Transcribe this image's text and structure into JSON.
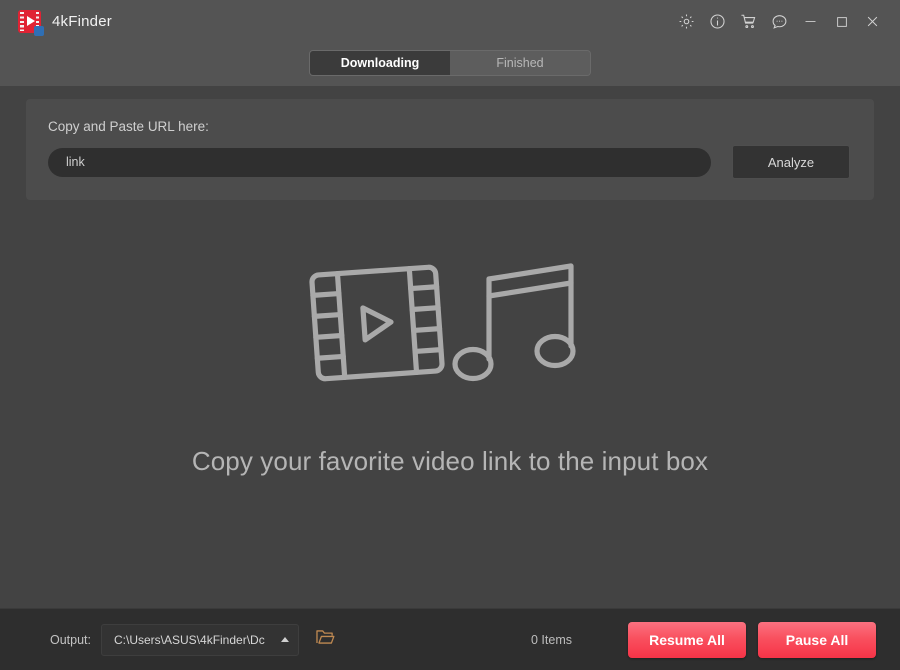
{
  "window": {
    "app_title": "4kFinder",
    "logo_icon": "film-play-icon",
    "controls": [
      {
        "name": "settings-icon",
        "label": "Settings"
      },
      {
        "name": "info-icon",
        "label": "Info"
      },
      {
        "name": "cart-icon",
        "label": "Store"
      },
      {
        "name": "chat-icon",
        "label": "Feedback"
      },
      {
        "name": "minimize-icon",
        "label": "Minimize"
      },
      {
        "name": "maximize-icon",
        "label": "Maximize"
      },
      {
        "name": "close-icon",
        "label": "Close"
      }
    ]
  },
  "tabs": [
    {
      "label": "Downloading",
      "active": true
    },
    {
      "label": "Finished",
      "active": false
    }
  ],
  "url_panel": {
    "label": "Copy and Paste URL here:",
    "input_value": "link",
    "input_placeholder": "link",
    "analyze_label": "Analyze"
  },
  "empty_state": {
    "message": "Copy your favorite video link to the input box",
    "icons": [
      "film-strip-icon",
      "music-note-icon"
    ]
  },
  "footer": {
    "output_label": "Output:",
    "output_path": "C:\\Users\\ASUS\\4kFinder\\Dc",
    "folder_icon": "open-folder-icon",
    "items_count": "0 Items",
    "resume_label": "Resume All",
    "pause_label": "Pause All"
  },
  "colors": {
    "window_bg": "#434343",
    "header_bg": "#545454",
    "panel_bg": "#4c4c4c",
    "footer_bg": "#2e2e2e",
    "input_bg": "#2f2f2f",
    "accent_red": "#f63347",
    "accent_red_light": "#fb7180",
    "brand_red": "#e02334",
    "folder_tan": "#c08a52",
    "art_gray": "#a9a9a9"
  }
}
